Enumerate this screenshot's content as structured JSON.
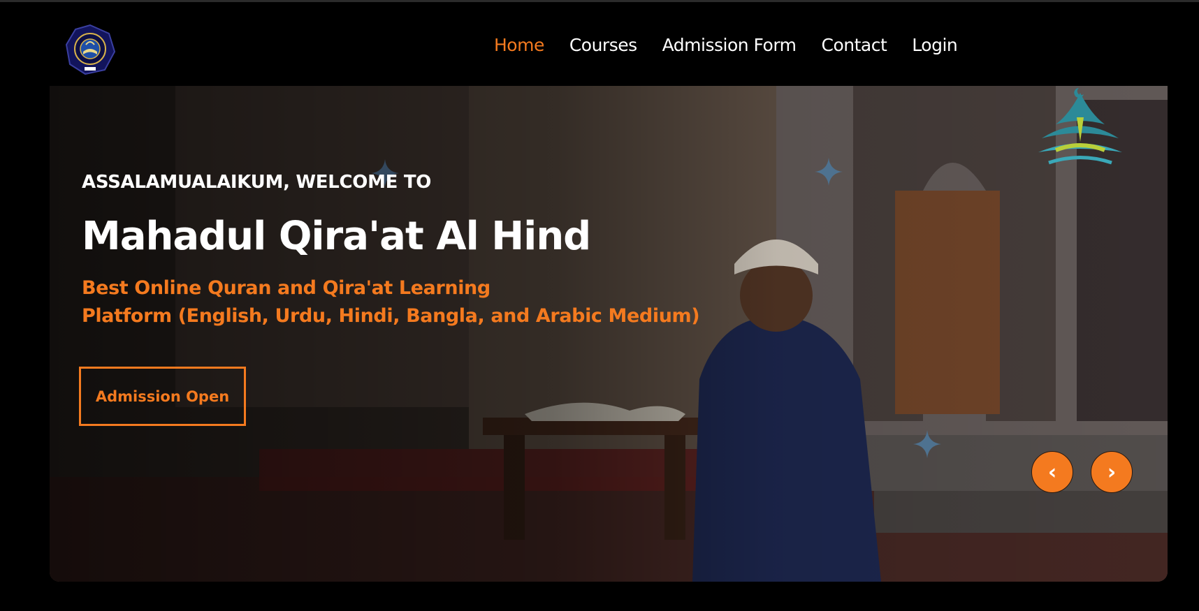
{
  "header": {
    "logo_icon": "institute-seal-logo",
    "nav": [
      {
        "label": "Home",
        "active": true
      },
      {
        "label": "Courses",
        "active": false
      },
      {
        "label": "Admission Form",
        "active": false
      },
      {
        "label": "Contact",
        "active": false
      },
      {
        "label": "Login",
        "active": false
      }
    ]
  },
  "hero": {
    "greeting": "ASSALAMUALAIKUM, WELCOME TO",
    "title": "Mahadul Qira'at Al Hind",
    "subtitle_line1": "Best Online Quran and Qira'at Learning",
    "subtitle_line2": "Platform (English, Urdu, Hindi, Bangla, and Arabic Medium)",
    "cta_label": "Admission Open",
    "prev_label": "‹",
    "next_label": "›",
    "decor_icon": "mosque-book-emblem-icon"
  },
  "colors": {
    "accent": "#f47a1f",
    "background": "#000000",
    "text": "#ffffff"
  }
}
